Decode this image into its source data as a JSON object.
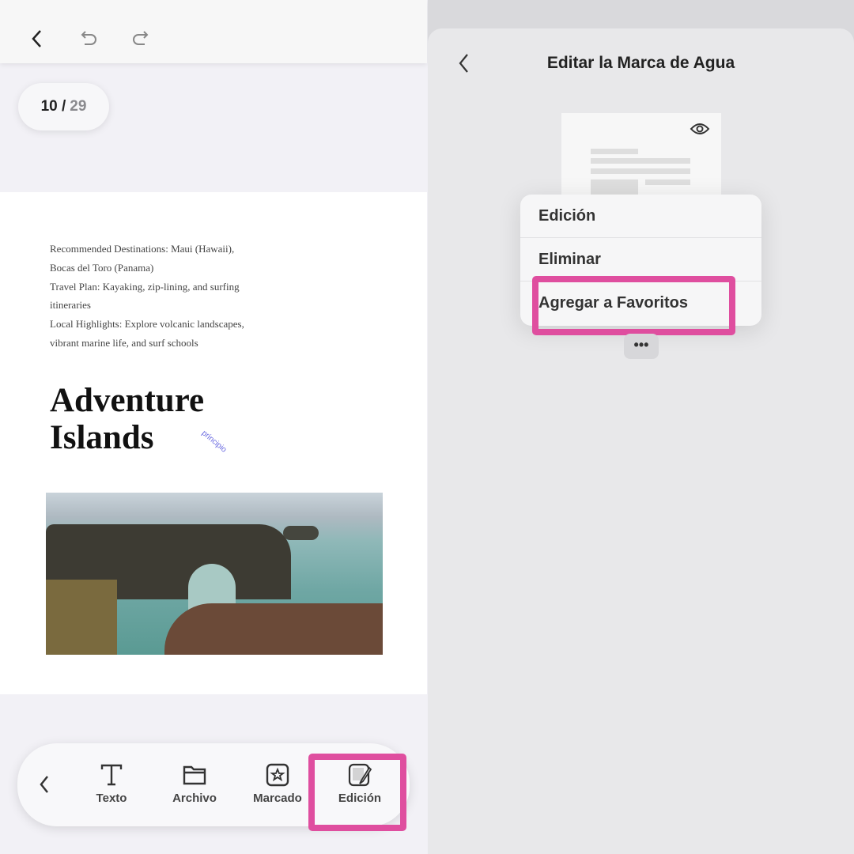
{
  "editor": {
    "pager": {
      "current": "10 /",
      "total": "29"
    },
    "document": {
      "lines": [
        "Recommended Destinations: Maui (Hawaii),",
        "Bocas del Toro (Panama)",
        "Travel Plan: Kayaking, zip-lining, and surfing",
        "itineraries",
        "Local Highlights: Explore volcanic landscapes,",
        "vibrant marine life, and surf schools"
      ],
      "heading_1": "Adventure",
      "heading_2": "Islands",
      "watermark": "principio"
    },
    "toolbar": {
      "items": [
        {
          "label": "Texto",
          "icon": "text-icon"
        },
        {
          "label": "Archivo",
          "icon": "folder-icon"
        },
        {
          "label": "Marcado",
          "icon": "star-stamp-icon"
        },
        {
          "label": "Edición",
          "icon": "watermark-edit-icon"
        }
      ]
    }
  },
  "watermark_panel": {
    "title": "Editar la Marca de Agua",
    "menu": [
      "Edición",
      "Eliminar",
      "Agregar a Favoritos"
    ],
    "more": "•••"
  },
  "colors": {
    "highlight": "#df4e9f",
    "watermark": "#6a6ae0"
  }
}
